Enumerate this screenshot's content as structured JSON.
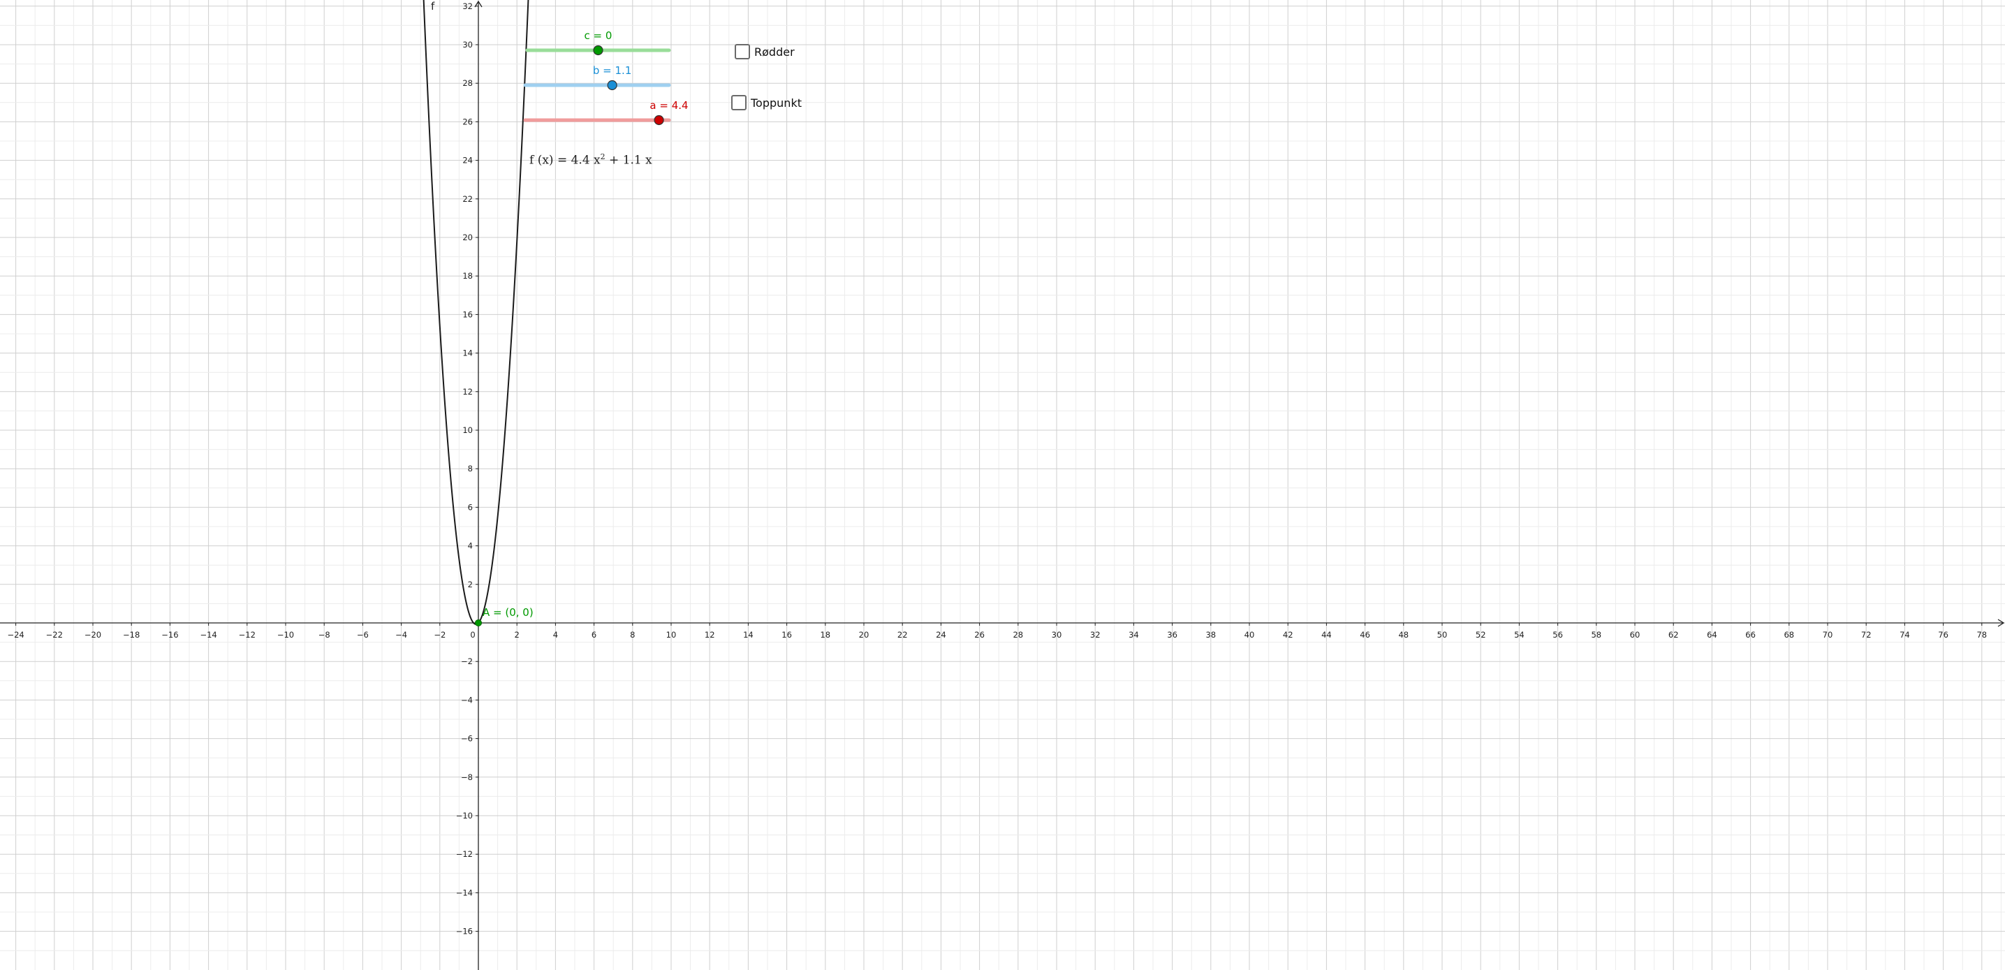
{
  "app": "GeoGebra graphing view",
  "axes": {
    "x_range": [
      -24.4,
      79.2
    ],
    "y_range": [
      -17.7,
      32.2
    ],
    "x_step": 2,
    "y_step": 2,
    "grid": true,
    "y_axis_name": "f"
  },
  "chart_data": {
    "type": "line",
    "title": "",
    "xlabel": "",
    "ylabel": "f",
    "xlim": [
      -24.4,
      79.2
    ],
    "ylim": [
      -17.7,
      32.2
    ],
    "series": [
      {
        "name": "f",
        "function": "4.4 x^2 + 1.1 x",
        "a": 4.4,
        "b": 1.1,
        "c": 0
      }
    ],
    "points": [
      {
        "label": "A = (0, 0)",
        "x": 0,
        "y": 0
      }
    ]
  },
  "sliders": [
    {
      "id": "c",
      "label": "c = 0",
      "value": 0,
      "fraction": 0.5,
      "color": "#009900",
      "track_color": "#99dd99"
    },
    {
      "id": "b",
      "label": "b = 1.1",
      "value": 1.1,
      "fraction": 0.605,
      "color": "#1a8fd6",
      "track_color": "#9fd0f0"
    },
    {
      "id": "a",
      "label": "a = 4.4",
      "value": 4.4,
      "fraction": 0.93,
      "color": "#cc0000",
      "track_color": "#f09c9c"
    }
  ],
  "checkboxes": [
    {
      "id": "roots",
      "label": "Rødder",
      "checked": false
    },
    {
      "id": "vertex",
      "label": "Toppunkt",
      "checked": false
    }
  ],
  "formula": {
    "lhs": "f (x)  =  4.4 x",
    "exp": "2",
    "rhs": " + 1.1 x"
  },
  "point_label": "A = (0, 0)",
  "colors": {
    "grid": "#d8d8d8",
    "axis": "#222222",
    "curve": "#1a1a1a",
    "point": "#009900"
  }
}
